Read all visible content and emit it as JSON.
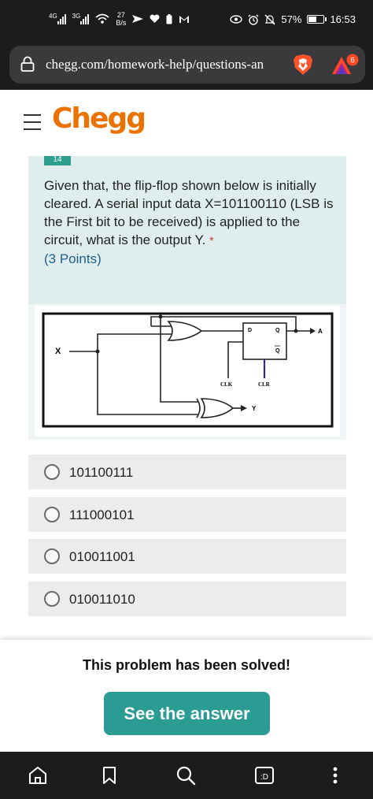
{
  "status_bar": {
    "network_1": "4G",
    "network_2": "3G",
    "data_rate_value": "27",
    "data_rate_unit": "B/s",
    "battery_percent": "57%",
    "battery_level": 0.57,
    "time": "16:53"
  },
  "browser": {
    "url": "chegg.com/homework-help/questions-an",
    "rewards_badge": "6"
  },
  "header": {
    "logo": "Chegg"
  },
  "question": {
    "number": "14",
    "text": "Given that, the flip-flop shown below is initially cleared. A serial input data X=101100110 (LSB is the First bit to be received) is applied to the circuit, what is the output Y.",
    "required_mark": "*",
    "points": "(3 Points)"
  },
  "circuit": {
    "input_label": "X",
    "output_a_label": "A",
    "output_y_label": "Y",
    "d_label": "D",
    "q_label": "Q",
    "qbar_label": "Q",
    "clk_label": "CLK",
    "clr_label": "CLR"
  },
  "options": [
    {
      "label": "101100111"
    },
    {
      "label": "111000101"
    },
    {
      "label": "010011001"
    },
    {
      "label": "010011010"
    }
  ],
  "solved": {
    "title": "This problem has been solved!",
    "button_label": "See the answer"
  },
  "colors": {
    "chegg_orange": "#eb7100",
    "teal_button": "#2a9c93",
    "question_bg": "#dfeeed"
  }
}
